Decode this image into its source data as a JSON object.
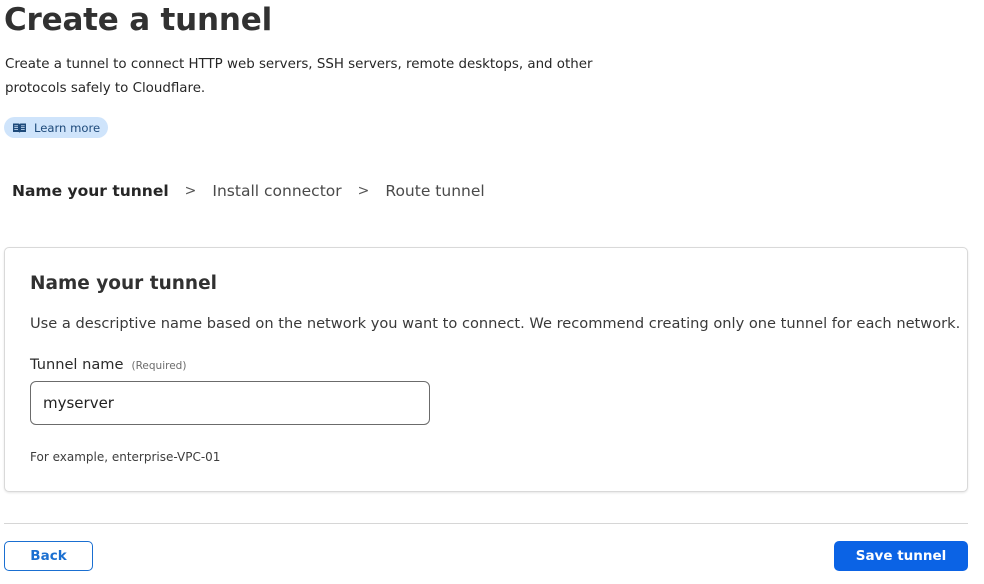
{
  "header": {
    "title": "Create a tunnel",
    "description": "Create a tunnel to connect HTTP web servers, SSH servers, remote desktops, and other protocols safely to Cloudflare.",
    "learn_more": {
      "label": "Learn more",
      "icon": "book-icon"
    }
  },
  "stepper": {
    "steps": [
      "Name your tunnel",
      "Install connector",
      "Route tunnel"
    ],
    "active_index": 0,
    "separator": ">"
  },
  "form": {
    "title": "Name your tunnel",
    "description": "Use a descriptive name based on the network you want to connect. We recommend creating only one tunnel for each network.",
    "field_label": "Tunnel name",
    "required_label": "(Required)",
    "value": "myserver",
    "hint": "For example, enterprise-VPC-01"
  },
  "footer": {
    "back_label": "Back",
    "save_label": "Save tunnel"
  },
  "colors": {
    "primary": "#0b63e5",
    "pill_bg": "#cfe4fb"
  }
}
